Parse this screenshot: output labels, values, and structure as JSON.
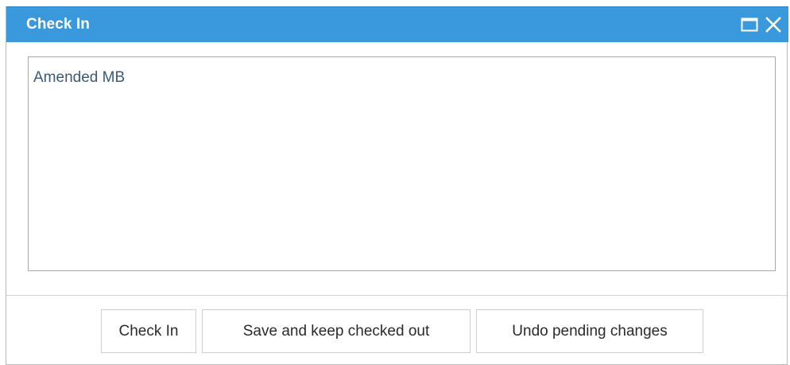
{
  "dialog": {
    "title": "Check In",
    "maximize_icon": "maximize-icon",
    "close_icon": "close-icon"
  },
  "comment": {
    "value": "Amended MB"
  },
  "buttons": {
    "check_in": "Check In",
    "save_keep": "Save and keep checked out",
    "undo": "Undo pending changes"
  },
  "colors": {
    "titlebar": "#3a98dc",
    "title_text": "#ffffff",
    "comment_text": "#3a5a7a"
  }
}
